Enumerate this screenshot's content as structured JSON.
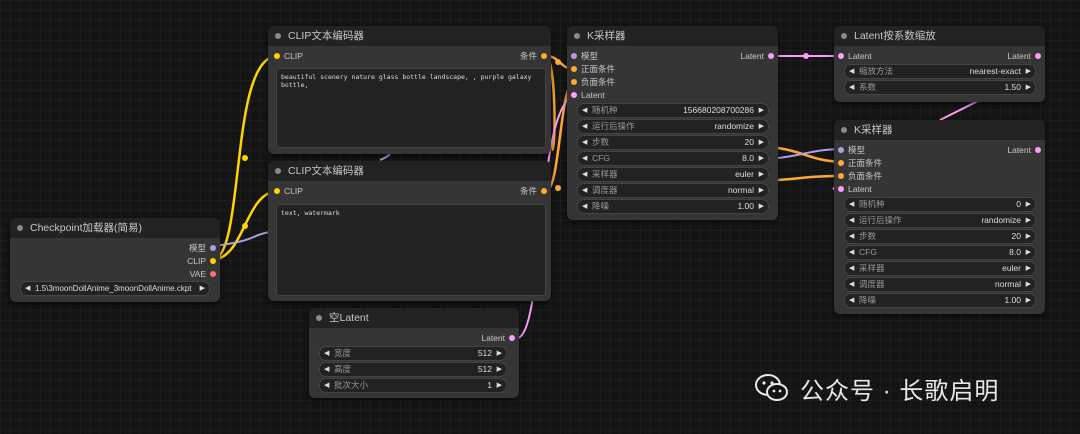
{
  "colors": {
    "clip": "#ffd500",
    "conditioning": "#ffa931",
    "latent": "#ff9cf9",
    "model": "#b39ddb",
    "vae": "#ff6e6e"
  },
  "checkpoint": {
    "title": "Checkpoint加载器(简易)",
    "out_model": "模型",
    "out_clip": "CLIP",
    "out_vae": "VAE",
    "ckpt_value": "1.5\\3moonDollAnime_3moonDollAnime.ckpt"
  },
  "clip1": {
    "title": "CLIP文本编码器",
    "in_clip": "CLIP",
    "out": "条件",
    "text": "beautiful scenery nature glass bottle landscape, , purple galaxy bottle,"
  },
  "clip2": {
    "title": "CLIP文本编码器",
    "in_clip": "CLIP",
    "out": "条件",
    "text": "text, watermark"
  },
  "empty_latent": {
    "title": "空Latent",
    "out": "Latent",
    "widgets": [
      {
        "label": "宽度",
        "value": "512"
      },
      {
        "label": "高度",
        "value": "512"
      },
      {
        "label": "批次大小",
        "value": "1"
      }
    ]
  },
  "ksampler1": {
    "title": "K采样器",
    "in_model": "模型",
    "in_pos": "正面条件",
    "in_neg": "负面条件",
    "in_latent": "Latent",
    "out": "Latent",
    "widgets": [
      {
        "label": "随机种",
        "value": "156680208700286"
      },
      {
        "label": "运行后操作",
        "value": "randomize"
      },
      {
        "label": "步数",
        "value": "20"
      },
      {
        "label": "CFG",
        "value": "8.0"
      },
      {
        "label": "采样器",
        "value": "euler"
      },
      {
        "label": "调度器",
        "value": "normal"
      },
      {
        "label": "降噪",
        "value": "1.00"
      }
    ]
  },
  "latent_upscale": {
    "title": "Latent按系数缩放",
    "in_latent": "Latent",
    "out": "Latent",
    "widgets": [
      {
        "label": "缩放方法",
        "value": "nearest-exact"
      },
      {
        "label": "系数",
        "value": "1.50"
      }
    ]
  },
  "ksampler2": {
    "title": "K采样器",
    "in_model": "模型",
    "in_pos": "正面条件",
    "in_neg": "负面条件",
    "in_latent": "Latent",
    "out": "Latent",
    "widgets": [
      {
        "label": "随机种",
        "value": "0"
      },
      {
        "label": "运行后操作",
        "value": "randomize"
      },
      {
        "label": "步数",
        "value": "20"
      },
      {
        "label": "CFG",
        "value": "8.0"
      },
      {
        "label": "采样器",
        "value": "euler"
      },
      {
        "label": "调度器",
        "value": "normal"
      },
      {
        "label": "降噪",
        "value": "1.00"
      }
    ]
  },
  "watermark": {
    "text": "公众号 · 长歌启明",
    "icon": "wechat-icon"
  }
}
